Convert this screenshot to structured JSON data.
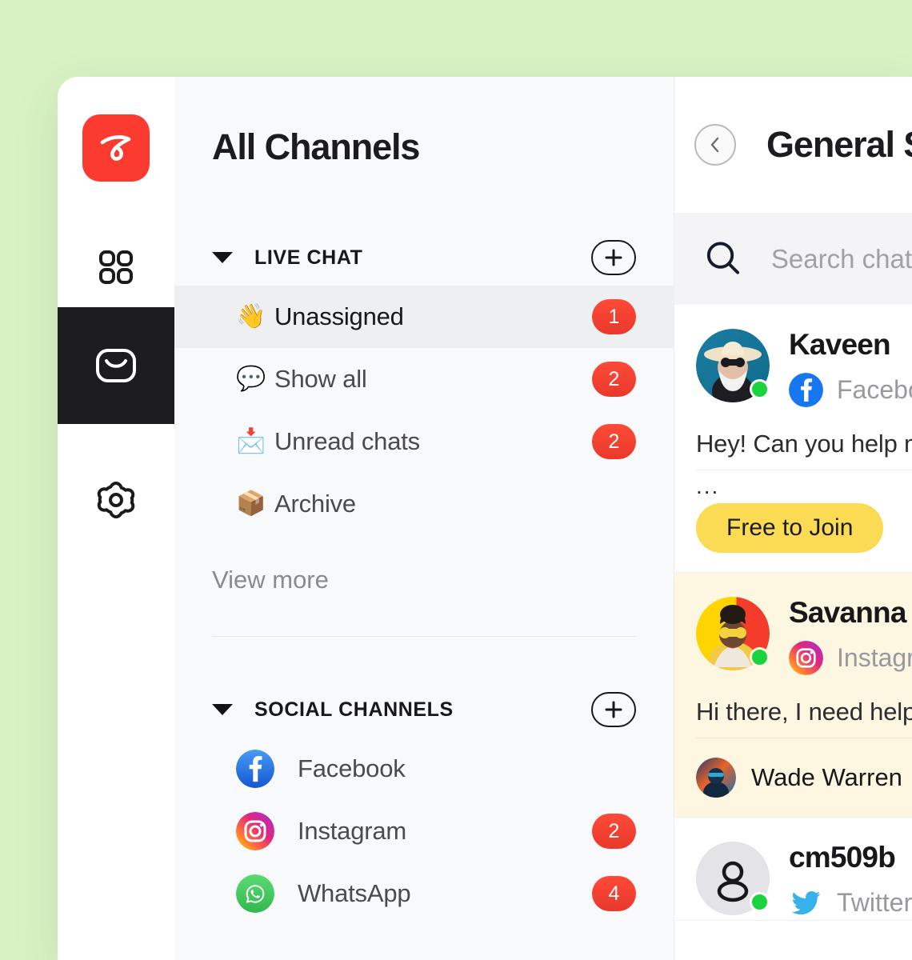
{
  "theme": {
    "page_background": "#d8f2c4",
    "brand_red": "#fb3b30",
    "badge_red": "#ff4a38",
    "tag_yellow": "#fbdb54",
    "highlight_row": "#fdf7e2",
    "online_green": "#19d43f",
    "active_nav": "#1d1d20"
  },
  "rail": {
    "logo_name": "app-logo",
    "items": [
      {
        "icon": "grid-icon",
        "active": false
      },
      {
        "icon": "inbox-envelope-icon",
        "active": true
      },
      {
        "icon": "gear-icon",
        "active": false
      }
    ]
  },
  "channels_panel": {
    "title": "All Channels",
    "live_chat": {
      "label": "LIVE CHAT",
      "caret_icon": "chevron-down-icon",
      "add_icon": "plus-icon",
      "items": [
        {
          "emoji": "wave-emoji",
          "label": "Unassigned",
          "badge": "1",
          "selected": true
        },
        {
          "emoji": "speech-balloon-emoji",
          "label": "Show all",
          "badge": "2",
          "selected": false
        },
        {
          "emoji": "incoming-envelope-emoji",
          "label": "Unread chats",
          "badge": "2",
          "selected": false
        },
        {
          "emoji": "package-emoji",
          "label": "Archive",
          "badge": "",
          "selected": false
        }
      ],
      "view_more": "View more"
    },
    "social_channels": {
      "label": "SOCIAL CHANNELS",
      "caret_icon": "chevron-down-icon",
      "add_icon": "plus-icon",
      "items": [
        {
          "icon": "facebook-icon",
          "label": "Facebook",
          "badge": ""
        },
        {
          "icon": "instagram-icon",
          "label": "Instagram",
          "badge": "2"
        },
        {
          "icon": "whatsapp-icon",
          "label": "WhatsApp",
          "badge": "4"
        }
      ]
    }
  },
  "chat_panel": {
    "back_icon": "chevron-left-icon",
    "title": "General Su",
    "search": {
      "icon": "search-icon",
      "placeholder": "Search chat"
    },
    "items": [
      {
        "name": "Kaveen",
        "avatar": "photo-avatar-man-hat",
        "source": "Facebook",
        "source_icon": "facebook-icon",
        "online": true,
        "preview": "Hey! Can you help me",
        "ellipsis": "...",
        "tag": "Free to Join",
        "highlight": false
      },
      {
        "name": "Savanna",
        "avatar": "photo-avatar-woman-sunglasses",
        "source": "Instagra",
        "source_icon": "instagram-icon",
        "online": true,
        "preview": "Hi there, I need help",
        "assignee": "Wade Warren",
        "assignee_avatar": "photo-avatar-agent",
        "highlight": true
      },
      {
        "name": "cm509b",
        "avatar": "default-person-avatar",
        "source": "Twitter",
        "source_icon": "twitter-icon",
        "online": true,
        "preview": "",
        "highlight": false
      }
    ]
  }
}
